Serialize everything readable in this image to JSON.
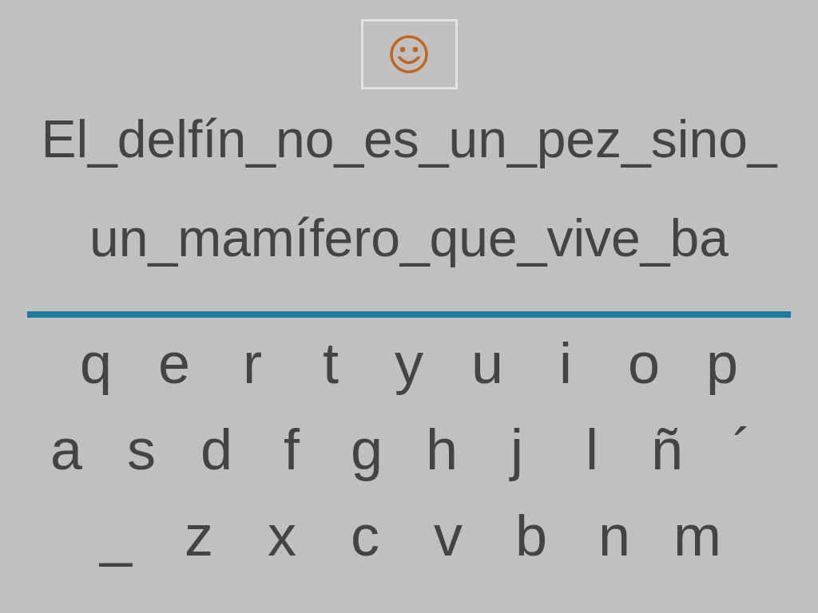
{
  "sentence_lines": [
    "El_delfín_no_es_un_pez_sino_",
    "un_mamífero_que_vive_ba"
  ],
  "keyboard": {
    "rows": [
      [
        "q",
        "e",
        "r",
        "t",
        "y",
        "u",
        "i",
        "o",
        "p"
      ],
      [
        "a",
        "s",
        "d",
        "f",
        "g",
        "h",
        "j",
        "l",
        "ñ",
        "´"
      ],
      [
        "_",
        "z",
        "x",
        "c",
        "v",
        "b",
        "n",
        "m"
      ]
    ]
  }
}
